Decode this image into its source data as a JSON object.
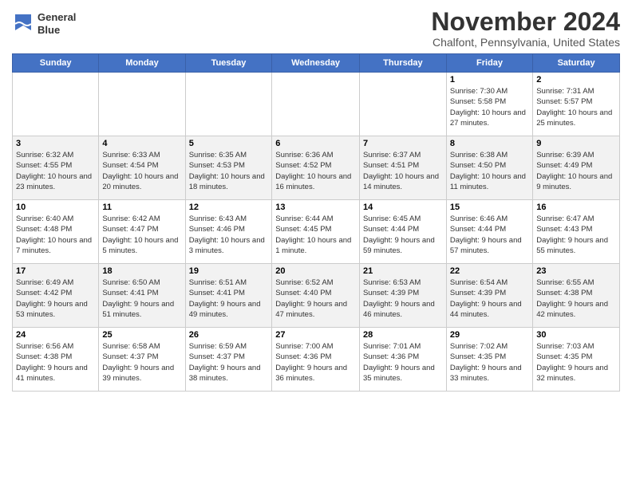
{
  "logo": {
    "line1": "General",
    "line2": "Blue"
  },
  "title": "November 2024",
  "subtitle": "Chalfont, Pennsylvania, United States",
  "days_of_week": [
    "Sunday",
    "Monday",
    "Tuesday",
    "Wednesday",
    "Thursday",
    "Friday",
    "Saturday"
  ],
  "weeks": [
    [
      {
        "day": "",
        "info": ""
      },
      {
        "day": "",
        "info": ""
      },
      {
        "day": "",
        "info": ""
      },
      {
        "day": "",
        "info": ""
      },
      {
        "day": "",
        "info": ""
      },
      {
        "day": "1",
        "info": "Sunrise: 7:30 AM\nSunset: 5:58 PM\nDaylight: 10 hours and 27 minutes."
      },
      {
        "day": "2",
        "info": "Sunrise: 7:31 AM\nSunset: 5:57 PM\nDaylight: 10 hours and 25 minutes."
      }
    ],
    [
      {
        "day": "3",
        "info": "Sunrise: 6:32 AM\nSunset: 4:55 PM\nDaylight: 10 hours and 23 minutes."
      },
      {
        "day": "4",
        "info": "Sunrise: 6:33 AM\nSunset: 4:54 PM\nDaylight: 10 hours and 20 minutes."
      },
      {
        "day": "5",
        "info": "Sunrise: 6:35 AM\nSunset: 4:53 PM\nDaylight: 10 hours and 18 minutes."
      },
      {
        "day": "6",
        "info": "Sunrise: 6:36 AM\nSunset: 4:52 PM\nDaylight: 10 hours and 16 minutes."
      },
      {
        "day": "7",
        "info": "Sunrise: 6:37 AM\nSunset: 4:51 PM\nDaylight: 10 hours and 14 minutes."
      },
      {
        "day": "8",
        "info": "Sunrise: 6:38 AM\nSunset: 4:50 PM\nDaylight: 10 hours and 11 minutes."
      },
      {
        "day": "9",
        "info": "Sunrise: 6:39 AM\nSunset: 4:49 PM\nDaylight: 10 hours and 9 minutes."
      }
    ],
    [
      {
        "day": "10",
        "info": "Sunrise: 6:40 AM\nSunset: 4:48 PM\nDaylight: 10 hours and 7 minutes."
      },
      {
        "day": "11",
        "info": "Sunrise: 6:42 AM\nSunset: 4:47 PM\nDaylight: 10 hours and 5 minutes."
      },
      {
        "day": "12",
        "info": "Sunrise: 6:43 AM\nSunset: 4:46 PM\nDaylight: 10 hours and 3 minutes."
      },
      {
        "day": "13",
        "info": "Sunrise: 6:44 AM\nSunset: 4:45 PM\nDaylight: 10 hours and 1 minute."
      },
      {
        "day": "14",
        "info": "Sunrise: 6:45 AM\nSunset: 4:44 PM\nDaylight: 9 hours and 59 minutes."
      },
      {
        "day": "15",
        "info": "Sunrise: 6:46 AM\nSunset: 4:44 PM\nDaylight: 9 hours and 57 minutes."
      },
      {
        "day": "16",
        "info": "Sunrise: 6:47 AM\nSunset: 4:43 PM\nDaylight: 9 hours and 55 minutes."
      }
    ],
    [
      {
        "day": "17",
        "info": "Sunrise: 6:49 AM\nSunset: 4:42 PM\nDaylight: 9 hours and 53 minutes."
      },
      {
        "day": "18",
        "info": "Sunrise: 6:50 AM\nSunset: 4:41 PM\nDaylight: 9 hours and 51 minutes."
      },
      {
        "day": "19",
        "info": "Sunrise: 6:51 AM\nSunset: 4:41 PM\nDaylight: 9 hours and 49 minutes."
      },
      {
        "day": "20",
        "info": "Sunrise: 6:52 AM\nSunset: 4:40 PM\nDaylight: 9 hours and 47 minutes."
      },
      {
        "day": "21",
        "info": "Sunrise: 6:53 AM\nSunset: 4:39 PM\nDaylight: 9 hours and 46 minutes."
      },
      {
        "day": "22",
        "info": "Sunrise: 6:54 AM\nSunset: 4:39 PM\nDaylight: 9 hours and 44 minutes."
      },
      {
        "day": "23",
        "info": "Sunrise: 6:55 AM\nSunset: 4:38 PM\nDaylight: 9 hours and 42 minutes."
      }
    ],
    [
      {
        "day": "24",
        "info": "Sunrise: 6:56 AM\nSunset: 4:38 PM\nDaylight: 9 hours and 41 minutes."
      },
      {
        "day": "25",
        "info": "Sunrise: 6:58 AM\nSunset: 4:37 PM\nDaylight: 9 hours and 39 minutes."
      },
      {
        "day": "26",
        "info": "Sunrise: 6:59 AM\nSunset: 4:37 PM\nDaylight: 9 hours and 38 minutes."
      },
      {
        "day": "27",
        "info": "Sunrise: 7:00 AM\nSunset: 4:36 PM\nDaylight: 9 hours and 36 minutes."
      },
      {
        "day": "28",
        "info": "Sunrise: 7:01 AM\nSunset: 4:36 PM\nDaylight: 9 hours and 35 minutes."
      },
      {
        "day": "29",
        "info": "Sunrise: 7:02 AM\nSunset: 4:35 PM\nDaylight: 9 hours and 33 minutes."
      },
      {
        "day": "30",
        "info": "Sunrise: 7:03 AM\nSunset: 4:35 PM\nDaylight: 9 hours and 32 minutes."
      }
    ]
  ]
}
